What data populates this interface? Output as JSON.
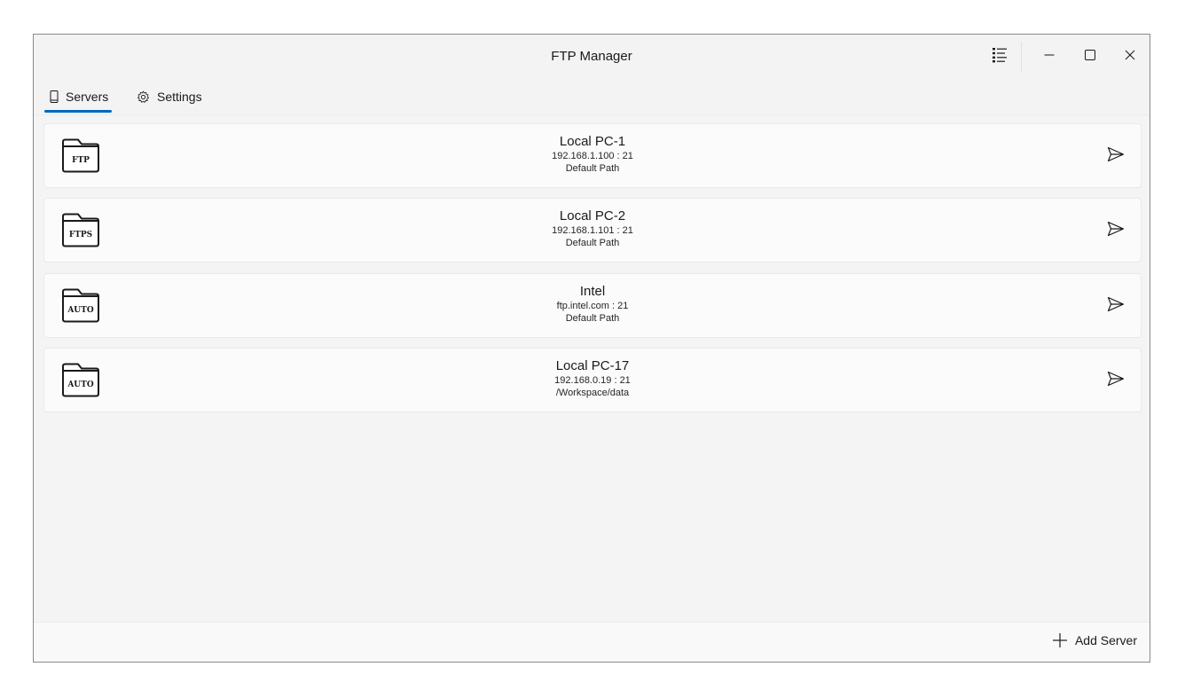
{
  "window": {
    "title": "FTP Manager"
  },
  "caption": {
    "icons": [
      "list-icon",
      "minimize-icon",
      "maximize-icon",
      "close-icon"
    ]
  },
  "tabs": [
    {
      "label": "Servers",
      "icon": "phone-icon",
      "selected": true
    },
    {
      "label": "Settings",
      "icon": "gear-icon",
      "selected": false
    }
  ],
  "servers": [
    {
      "name": "Local PC-1",
      "address": "192.168.1.100 : 21",
      "path": "Default Path",
      "protocol": "FTP"
    },
    {
      "name": "Local PC-2",
      "address": "192.168.1.101 : 21",
      "path": "Default Path",
      "protocol": "FTPS"
    },
    {
      "name": "Intel",
      "address": "ftp.intel.com : 21",
      "path": "Default Path",
      "protocol": "AUTO"
    },
    {
      "name": "Local PC-17",
      "address": "192.168.0.19 : 21",
      "path": "/Workspace/data",
      "protocol": "AUTO"
    }
  ],
  "footer": {
    "add_label": "Add Server"
  },
  "colors": {
    "accent": "#0067c0",
    "background": "#f3f3f3",
    "card": "#fbfbfb"
  }
}
